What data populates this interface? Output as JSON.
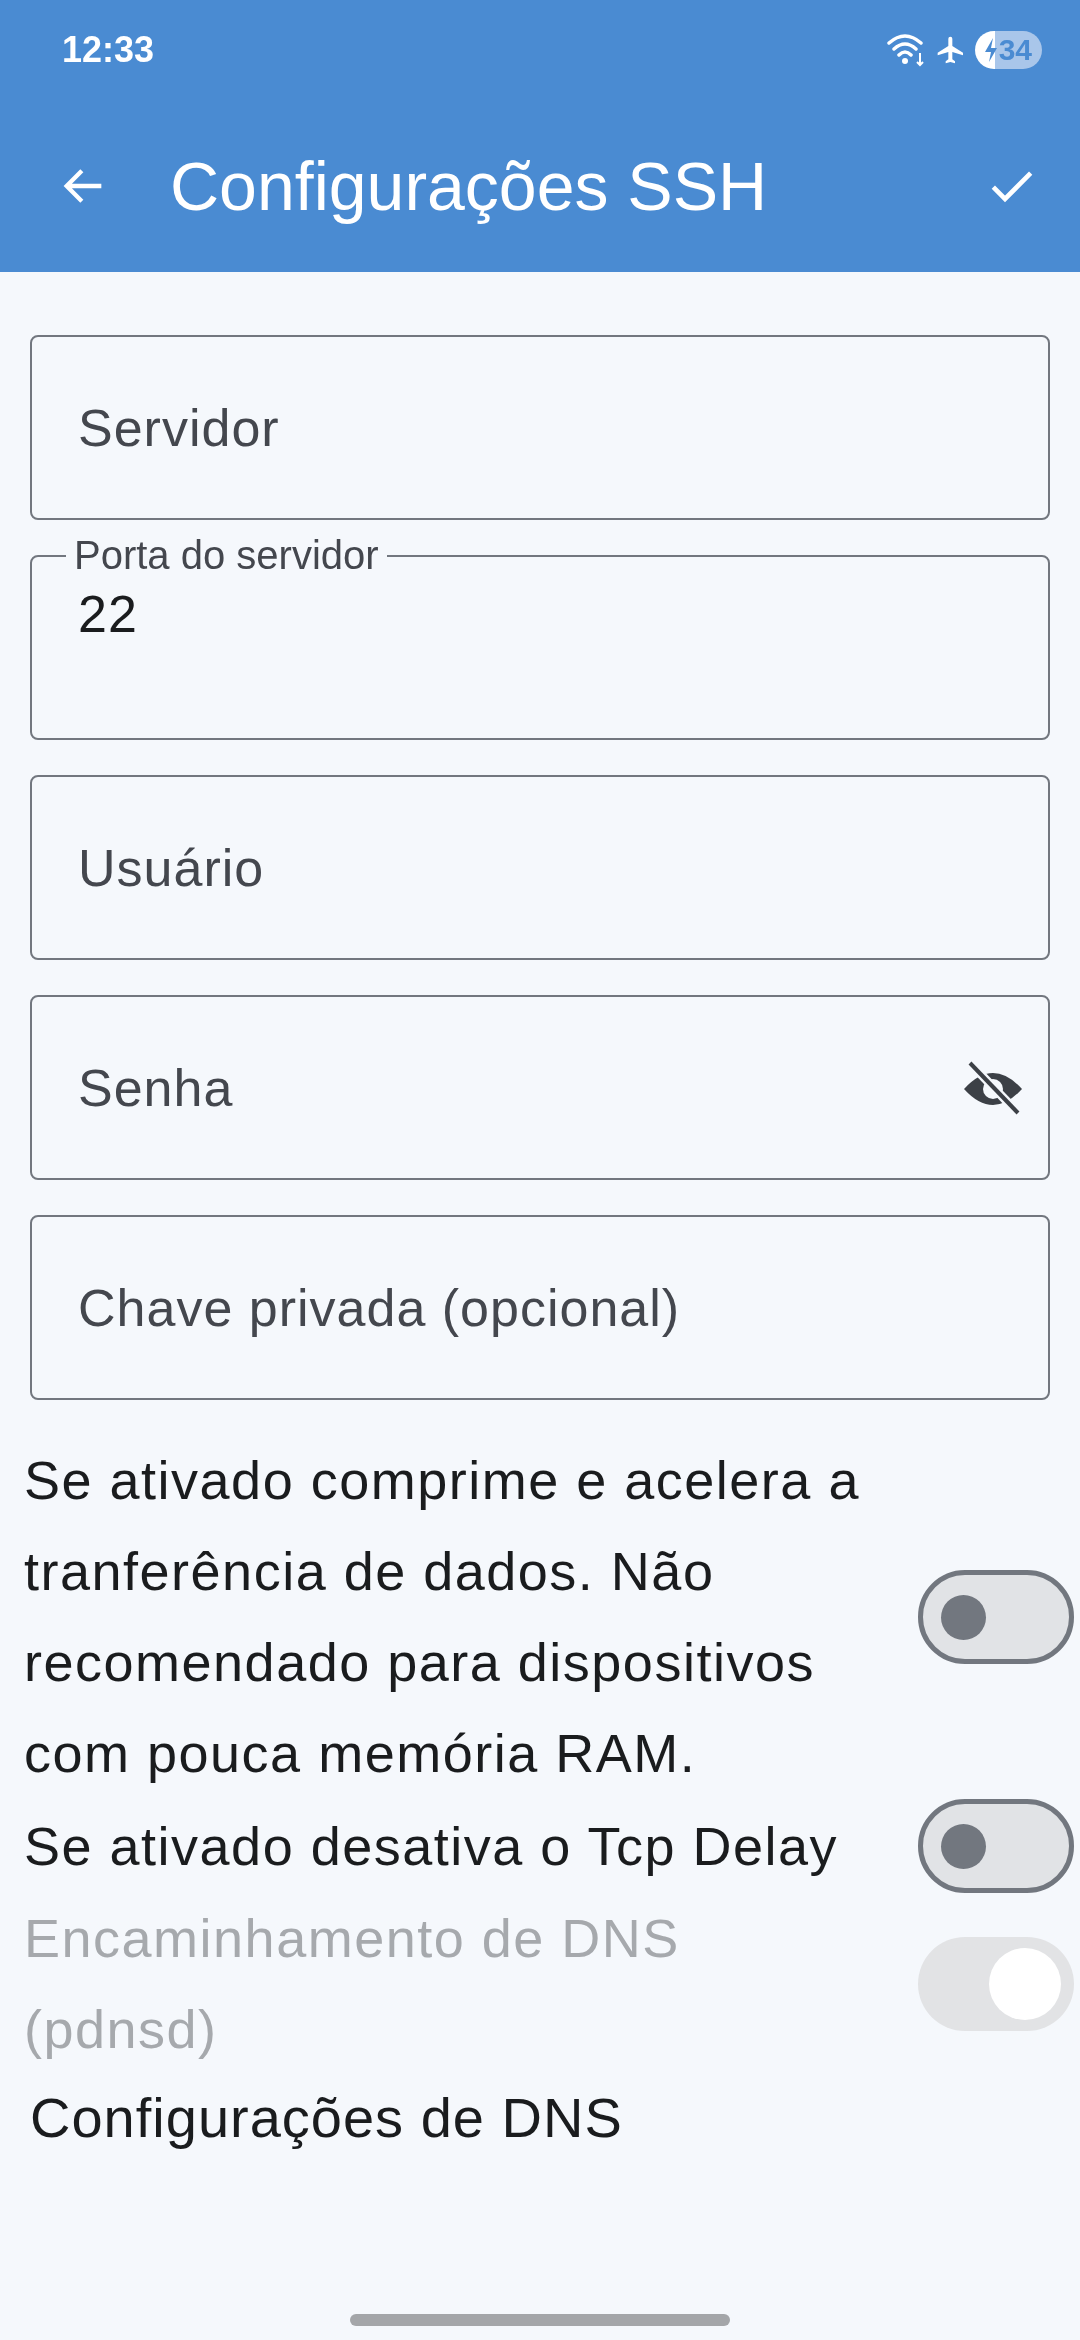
{
  "status_bar": {
    "time": "12:33",
    "battery": "34"
  },
  "app_bar": {
    "title": "Configurações SSH"
  },
  "fields": [
    {
      "kind": "text",
      "placeholder": "Servidor"
    },
    {
      "kind": "labeled",
      "label": "Porta do servidor",
      "value": "22"
    },
    {
      "kind": "text",
      "placeholder": "Usuário"
    },
    {
      "kind": "password",
      "placeholder": "Senha"
    },
    {
      "kind": "text",
      "placeholder": "Chave privada (opcional)"
    }
  ],
  "settings": [
    {
      "text": "Se ativado comprime e acelera a tranferência de dados. Não recomendado para dispositivos com pouca memória RAM.",
      "on": false,
      "disabled": false
    },
    {
      "text": "Se ativado desativa o Tcp Delay",
      "on": false,
      "disabled": false
    },
    {
      "text": "Encaminhamento de DNS (pdnsd)",
      "on": true,
      "disabled": true
    }
  ],
  "section_link": "Configurações de DNS"
}
